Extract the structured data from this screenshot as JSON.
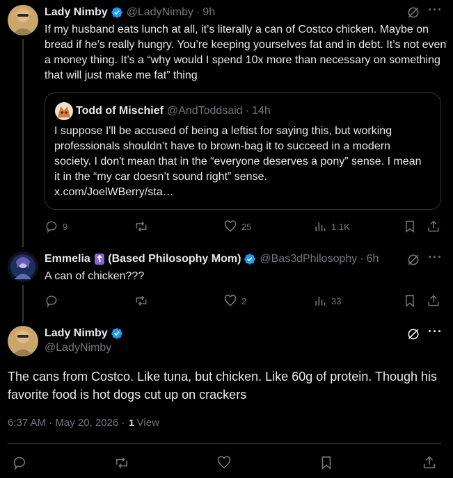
{
  "post1": {
    "name": "Lady Nimby",
    "handle": "@LadyNimby",
    "time": "9h",
    "text": "If my husband eats lunch at all, it’s literally a can of Costco chicken. Maybe on bread if he’s really hungry. You’re keeping yourselves fat and in debt. It’s not even a money thing. It’s a “why would I spend 10x more than necessary on something that will just make me fat” thing",
    "quote": {
      "name": "Todd of Mischief",
      "handle": "@AndToddsaid",
      "time": "14h",
      "text": "I suppose I'll be accused of being a leftist for saying this, but working professionals shouldn’t have to brown-bag it to succeed in a modern society. I don't mean that in the “everyone deserves a pony” sense. I mean it in the “my car doesn’t sound right” sense.",
      "link": "x.com/JoelWBerry/sta…"
    },
    "stats": {
      "replies": "9",
      "reposts": "",
      "likes": "25",
      "views": "1.1K"
    }
  },
  "post2": {
    "name": "Emmelia",
    "emoji": "☦",
    "name_suffix": "(Based Philosophy Mom)",
    "handle": "@Bas3dPhilosophy",
    "time": "6h",
    "text": "A can of chicken???",
    "stats": {
      "replies": "",
      "reposts": "",
      "likes": "2",
      "views": "33"
    }
  },
  "main": {
    "name": "Lady Nimby",
    "handle": "@LadyNimby",
    "text": "The cans from Costco. Like tuna, but chicken. Like 60g of protein. Though his favorite food is hot dogs cut up on crackers",
    "timestamp": "6:37 AM · May 20, 2026 ·",
    "views_count": "1",
    "views_label": "View"
  },
  "separator": "·",
  "colors": {
    "verified": "#1d9bf0",
    "muted": "#71767b",
    "border": "#2f3336"
  }
}
